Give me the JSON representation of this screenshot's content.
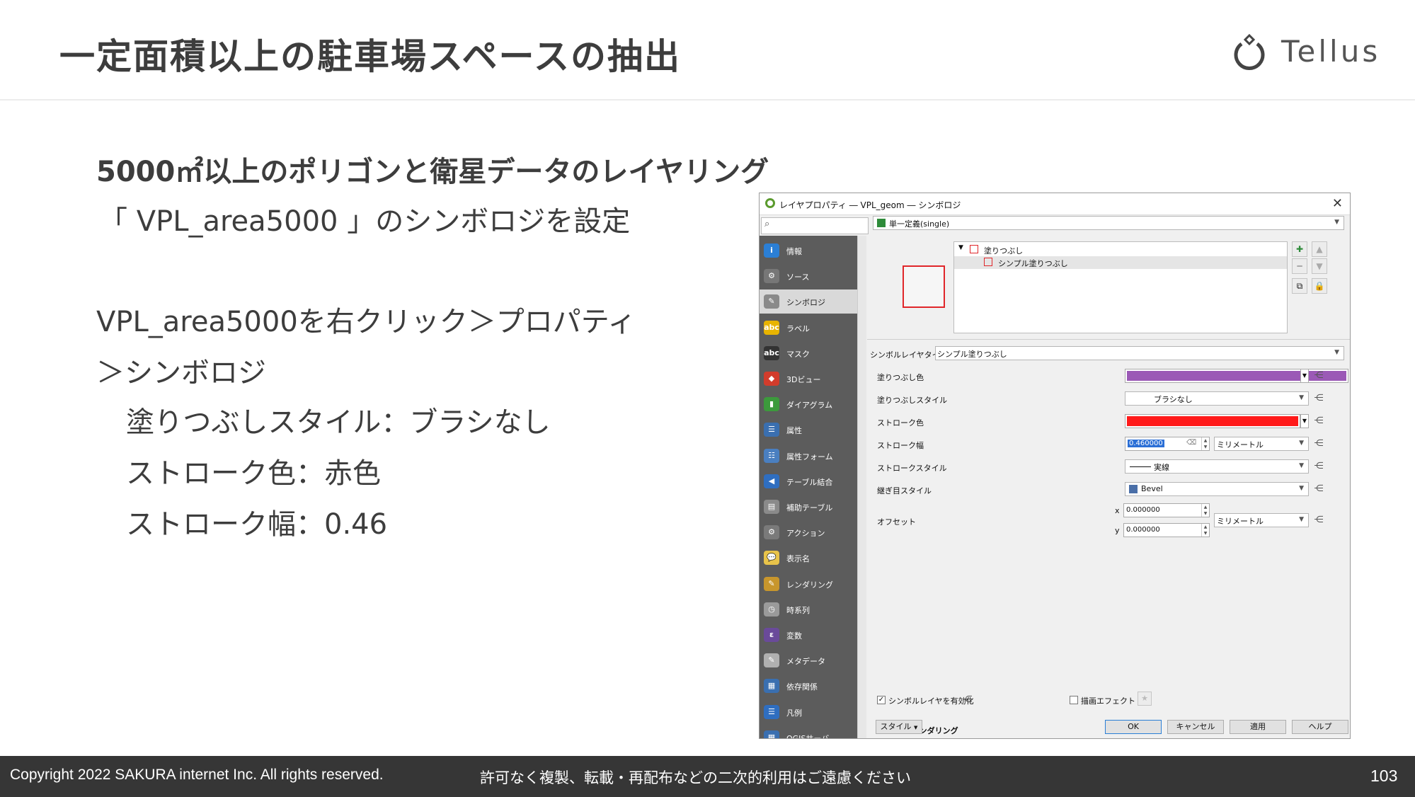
{
  "slide": {
    "title": "一定面積以上の駐車場スペースの抽出",
    "logo_text": "Tellus",
    "subheading": "5000㎡以上のポリゴンと衛星データのレイヤリング",
    "lines": [
      "「 VPL_area5000 」のシンボロジを設定",
      "VPL_area5000を右クリック＞プロパティ",
      "＞シンボロジ",
      "塗りつぶしスタイル：ブラシなし",
      "ストローク色：赤色",
      "ストローク幅：0.46"
    ]
  },
  "footer": {
    "copyright": "Copyright 2022 SAKURA internet Inc. All rights reserved.",
    "notice": "許可なく複製、転載・再配布などの二次的利用はご遠慮ください",
    "page": "103"
  },
  "dialog": {
    "title": "レイヤプロパティ ― VPL_geom ― シンボロジ",
    "close": "✕",
    "renderer": "単一定義(single)",
    "sidebar": [
      {
        "label": "情報",
        "icon": "info-icon",
        "color": "#2b7fd6",
        "glyph": "i"
      },
      {
        "label": "ソース",
        "icon": "source-icon",
        "color": "#777777",
        "glyph": "⚙"
      },
      {
        "label": "シンボロジ",
        "icon": "symbology-icon",
        "color": "#8a8a8a",
        "glyph": "✎",
        "selected": true
      },
      {
        "label": "ラベル",
        "icon": "label-icon",
        "color": "#e8b400",
        "glyph": "abc"
      },
      {
        "label": "マスク",
        "icon": "mask-icon",
        "color": "#333333",
        "glyph": "abc"
      },
      {
        "label": "3Dビュー",
        "icon": "3d-view-icon",
        "color": "#d23c2c",
        "glyph": "◆"
      },
      {
        "label": "ダイアグラム",
        "icon": "diagram-icon",
        "color": "#3c9a3c",
        "glyph": "▮"
      },
      {
        "label": "属性",
        "icon": "attributes-icon",
        "color": "#3a6fb0",
        "glyph": "☰"
      },
      {
        "label": "属性フォーム",
        "icon": "attributes-form-icon",
        "color": "#4a7fc0",
        "glyph": "☷"
      },
      {
        "label": "テーブル結合",
        "icon": "joins-icon",
        "color": "#2f6ec0",
        "glyph": "◀"
      },
      {
        "label": "補助テーブル",
        "icon": "auxiliary-storage-icon",
        "color": "#8a8a8a",
        "glyph": "▤"
      },
      {
        "label": "アクション",
        "icon": "actions-icon",
        "color": "#7a7a7a",
        "glyph": "⚙"
      },
      {
        "label": "表示名",
        "icon": "display-icon",
        "color": "#e8c34a",
        "glyph": "💬"
      },
      {
        "label": "レンダリング",
        "icon": "rendering-icon",
        "color": "#c8962c",
        "glyph": "✎"
      },
      {
        "label": "時系列",
        "icon": "temporal-icon",
        "color": "#9a9a9a",
        "glyph": "◷"
      },
      {
        "label": "変数",
        "icon": "variables-icon",
        "color": "#6a4a9a",
        "glyph": "ε"
      },
      {
        "label": "メタデータ",
        "icon": "metadata-icon",
        "color": "#b0b0b0",
        "glyph": "✎"
      },
      {
        "label": "依存関係",
        "icon": "dependencies-icon",
        "color": "#3a6fb0",
        "glyph": "▦"
      },
      {
        "label": "凡例",
        "icon": "legend-icon",
        "color": "#2f6ec0",
        "glyph": "☰"
      },
      {
        "label": "QGISサーバ",
        "icon": "qgis-server-icon",
        "color": "#3a6fb0",
        "glyph": "▦"
      }
    ],
    "tree": {
      "root": "塗りつぶし",
      "child": "シンプル塗りつぶし"
    },
    "symbol_layer_type_label": "シンボルレイヤタイプ",
    "symbol_layer_type": "シンプル塗りつぶし",
    "props": {
      "fill_color_label": "塗りつぶし色",
      "fill_color": "#9b59b6",
      "fill_style_label": "塗りつぶしスタイル",
      "fill_style": "ブラシなし",
      "stroke_color_label": "ストローク色",
      "stroke_color": "#ff1a1a",
      "stroke_width_label": "ストローク幅",
      "stroke_width": "0.460000",
      "stroke_width_unit": "ミリメートル",
      "stroke_style_label": "ストロークスタイル",
      "stroke_style": "実線",
      "join_style_label": "継ぎ目スタイル",
      "join_style": "Bevel",
      "offset_label": "オフセット",
      "offset_x_label": "x",
      "offset_x": "0.000000",
      "offset_y_label": "y",
      "offset_y": "0.000000",
      "offset_unit": "ミリメートル"
    },
    "enable_layer": "シンボルレイヤを有効化",
    "draw_effects": "描画エフェクト",
    "layer_rendering": "レイヤレンダリング",
    "buttons": {
      "style": "スタイル",
      "ok": "OK",
      "cancel": "キャンセル",
      "apply": "適用",
      "help": "ヘルプ"
    }
  }
}
